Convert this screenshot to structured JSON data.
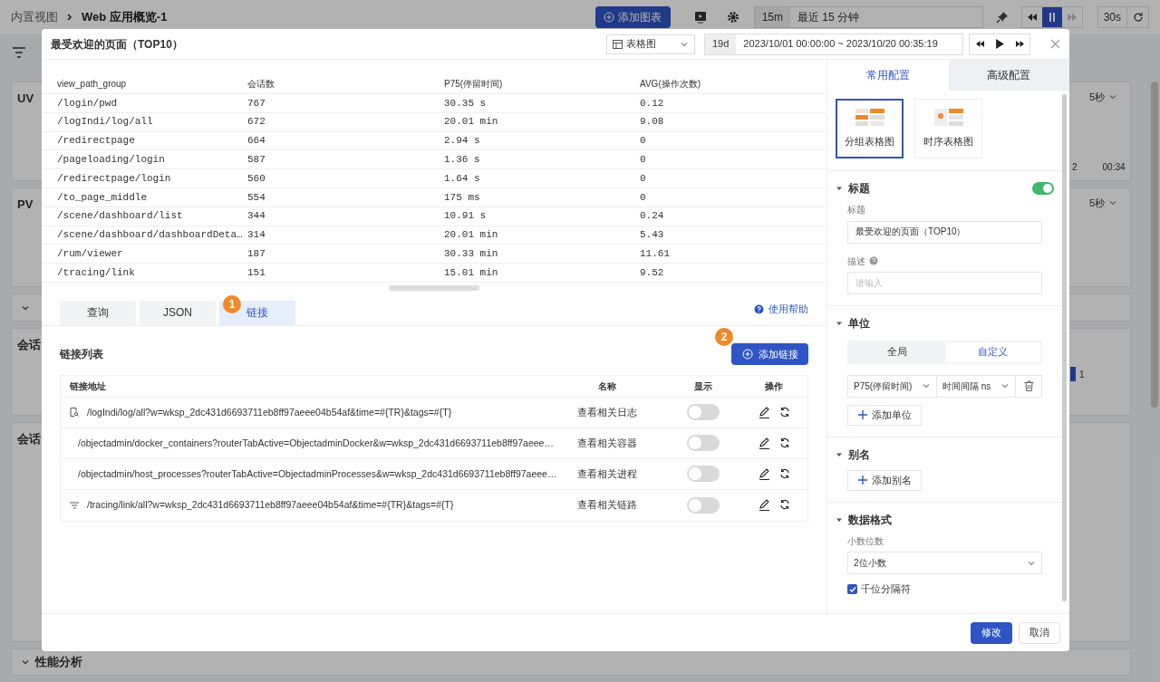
{
  "background": {
    "breadcrumb": [
      "内置视图",
      "Web 应用概览-1"
    ],
    "add_chart": "添加图表",
    "time_short": "15m",
    "time_range": "最近 15 分钟",
    "paused": true,
    "refresh_interval": "30s",
    "panels": [
      {
        "kind": "panel",
        "title": "UV",
        "interval": "5秒",
        "axis_labels": [
          "2",
          "00:34"
        ]
      },
      {
        "kind": "panel",
        "title": "PV",
        "interval": "5秒"
      },
      {
        "kind": "group",
        "expanded": true
      },
      {
        "kind": "panel",
        "title": "会话",
        "legend_value": "1"
      },
      {
        "kind": "panel",
        "title": "会话"
      },
      {
        "kind": "group",
        "title": "性能分析",
        "expanded": true
      }
    ]
  },
  "modal": {
    "title": "最受欢迎的页面（TOP10）",
    "view_type": "表格图",
    "duration": "19d",
    "time_range": "2023/10/01 00:00:00 ~ 2023/10/20 00:35:19",
    "table": {
      "columns": [
        "view_path_group",
        "会话数",
        "P75(停留时间)",
        "AVG(操作次数)"
      ],
      "rows": [
        [
          "/login/pwd",
          "767",
          "30.35 s",
          "0.12"
        ],
        [
          "/logIndi/log/all",
          "672",
          "20.01 min",
          "9.08"
        ],
        [
          "/redirectpage",
          "664",
          "2.94 s",
          "0"
        ],
        [
          "/pageloading/login",
          "587",
          "1.36 s",
          "0"
        ],
        [
          "/redirectpage/login",
          "560",
          "1.64 s",
          "0"
        ],
        [
          "/to_page_middle",
          "554",
          "175 ms",
          "0"
        ],
        [
          "/scene/dashboard/list",
          "344",
          "10.91 s",
          "0.24"
        ],
        [
          "/scene/dashboard/dashboardDeta…",
          "314",
          "20.01 min",
          "5.43"
        ],
        [
          "/rum/viewer",
          "187",
          "30.33 min",
          "11.61"
        ],
        [
          "/tracing/link",
          "151",
          "15.01 min",
          "9.52"
        ]
      ]
    },
    "editor_tabs": [
      {
        "label": "查询",
        "selected": false
      },
      {
        "label": "JSON",
        "selected": false
      },
      {
        "label": "链接",
        "selected": true,
        "badge": "1"
      }
    ],
    "help": "使用帮助",
    "links": {
      "title": "链接列表",
      "add_button": "添加链接",
      "add_badge": "2",
      "columns": [
        "链接地址",
        "名称",
        "显示",
        "操作"
      ],
      "rows": [
        {
          "kind": "log",
          "url": "/logIndi/log/all?w=wksp_2dc431d6693711eb8ff97aeee04b54af&time=#{TR}&tags=#{T}",
          "name": "查看相关日志",
          "shown": false
        },
        {
          "kind": "container",
          "url": "/objectadmin/docker_containers?routerTabActive=ObjectadminDocker&w=wksp_2dc431d6693711eb8ff97aeee…",
          "name": "查看相关容器",
          "shown": false
        },
        {
          "kind": "process",
          "url": "/objectadmin/host_processes?routerTabActive=ObjectadminProcesses&w=wksp_2dc431d6693711eb8ff97aeee…",
          "name": "查看相关进程",
          "shown": false
        },
        {
          "kind": "trace",
          "url": "/tracing/link/all?w=wksp_2dc431d6693711eb8ff97aeee04b54af&time=#{TR}&tags=#{T}",
          "name": "查看相关链路",
          "shown": false
        }
      ]
    },
    "config": {
      "tabs": [
        {
          "label": "常用配置",
          "selected": true
        },
        {
          "label": "高级配置",
          "selected": false
        }
      ],
      "chart_types": [
        {
          "kind": "grouped",
          "label": "分组表格图",
          "selected": true
        },
        {
          "kind": "timeseries",
          "label": "时序表格图",
          "selected": false
        }
      ],
      "title_section": {
        "heading": "标题",
        "expanded": true,
        "on": true,
        "title_label": "标题",
        "title_value": "最受欢迎的页面（TOP10）",
        "desc_label": "描述",
        "desc_placeholder": "请输入"
      },
      "unit_section": {
        "heading": "单位",
        "expanded": true,
        "scopes": [
          {
            "label": "全局",
            "selected": false
          },
          {
            "label": "自定义",
            "selected": true
          }
        ],
        "units": [
          {
            "field": "P75(停留时间)",
            "unit": "时间间隔 ns"
          }
        ],
        "add": "添加单位"
      },
      "alias_section": {
        "heading": "别名",
        "expanded": true,
        "add": "添加别名"
      },
      "format_section": {
        "heading": "数据格式",
        "expanded": true,
        "decimals_label": "小数位数",
        "decimals": "2位小数",
        "separator": {
          "label": "千位分隔符",
          "checked": true
        }
      }
    },
    "footer": [
      {
        "label": "修改",
        "kind": "primary"
      },
      {
        "label": "取消",
        "kind": "default"
      }
    ]
  }
}
